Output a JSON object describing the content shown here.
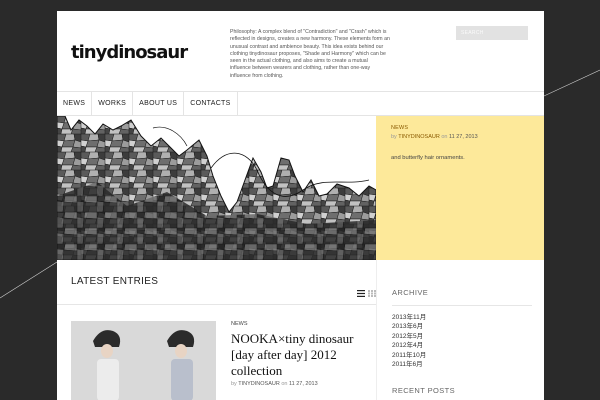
{
  "site": {
    "logo": "tinydinosaur",
    "philosophy": "Philosophy: A complex blend of \"Contradiction\" and \"Crash\" which is reflected in designs, creates a new harmony. These elements form an unusual contrast and ambience beauty. This idea exists behind our clothing tinydinosaur proposes, \"Shade and Harmony\" which can be seen in the actual clothing, and also aims to create a mutual influence between wearers and clothing, rather than one-way influence from clothing.",
    "search_placeholder": "SEARCH",
    "colors": {
      "background": "#2a2a2a",
      "feature_box": "#fde99a",
      "accent": "#8a5a00"
    }
  },
  "nav": {
    "items": [
      "NEWS",
      "WORKS",
      "ABOUT US",
      "CONTACTS"
    ]
  },
  "feature": {
    "category": "NEWS",
    "by": "by",
    "author": "TINYDINOSAUR",
    "on": "on",
    "date": "11  27, 2013",
    "text": "and butterfly hair ornaments."
  },
  "main": {
    "title": "LATEST ENTRIES",
    "view_icons": [
      "list-view-icon",
      "grid-view-icon"
    ],
    "entry": {
      "category": "NEWS",
      "title": "NOOKA×tiny dinosaur [day after day] 2012 collection",
      "by": "by",
      "author": "TINYDINOSAUR",
      "on": "on",
      "date": "11  27, 2013"
    }
  },
  "sidebar": {
    "archive_title": "ARCHIVE",
    "archive": [
      "2013年11月",
      "2013年6月",
      "2012年5月",
      "2012年4月",
      "2011年10月",
      "2011年6月"
    ],
    "recent_title": "RECENT POSTS"
  }
}
